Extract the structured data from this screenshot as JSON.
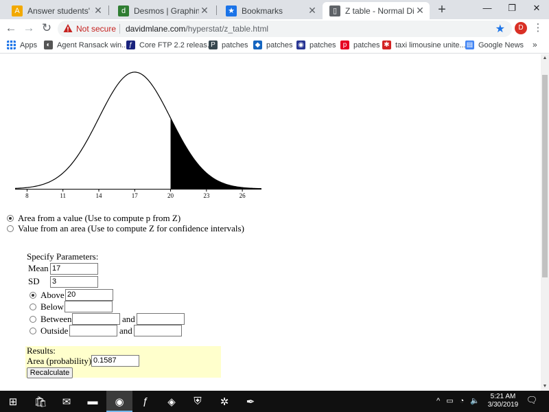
{
  "browser": {
    "tabs": [
      {
        "title": "Answer students' questio",
        "icon": "answers-site-icon",
        "favColor": "#f2a900",
        "glyph": "A"
      },
      {
        "title": "Desmos | Graphing Calcu",
        "icon": "desmos-icon",
        "favColor": "#2f7d32",
        "glyph": "d"
      },
      {
        "title": "Bookmarks",
        "icon": "bookmark-star-icon",
        "favColor": "#1a73e8",
        "glyph": "★"
      },
      {
        "title": "Z table - Normal Distribu",
        "icon": "page-icon",
        "favColor": "#5f6368",
        "glyph": "▯",
        "active": true
      }
    ],
    "new_tab_label": "+",
    "window_controls": {
      "minimize": "—",
      "restore": "❐",
      "close": "✕"
    },
    "security_label": "Not secure",
    "url_host": "davidmlane.com",
    "url_path": "/hyperstat/z_table.html",
    "profile_initial": "D"
  },
  "bookmarks": {
    "apps_label": "Apps",
    "items": [
      {
        "label": "Agent Ransack win...",
        "icon": "agent-ransack-icon",
        "color": "#555555",
        "glyph": "◐"
      },
      {
        "label": "Core FTP 2.2 releas...",
        "icon": "coreftp-icon",
        "color": "#1a237e",
        "glyph": "ƒ"
      },
      {
        "label": "patches",
        "icon": "patches-p-icon",
        "color": "#37474f",
        "glyph": "P"
      },
      {
        "label": "patches",
        "icon": "patches-drop-icon",
        "color": "#1565c0",
        "glyph": "◆"
      },
      {
        "label": "patches",
        "icon": "patches-circle-icon",
        "color": "#283593",
        "glyph": "◉"
      },
      {
        "label": "patches",
        "icon": "pinterest-icon",
        "color": "#e60023",
        "glyph": "p"
      },
      {
        "label": "taxi limousine unite...",
        "icon": "yelp-icon",
        "color": "#d32323",
        "glyph": "✱"
      },
      {
        "label": "Google News",
        "icon": "google-news-icon",
        "color": "#4285f4",
        "glyph": "▤"
      }
    ],
    "more_label": "»"
  },
  "z_table": {
    "chart_data": {
      "type": "area",
      "title": "",
      "distribution": "normal",
      "mean": 17,
      "sd": 3,
      "xlim": [
        7,
        27.6
      ],
      "x_ticks": [
        8,
        11,
        14,
        17,
        20,
        23,
        26
      ],
      "shaded_region": {
        "from": 20,
        "to": 27.6
      }
    },
    "mode_options": [
      {
        "label": "Area from a value (Use to compute p from Z)",
        "selected": true
      },
      {
        "label": "Value from an area (Use to compute Z for confidence intervals)",
        "selected": false
      }
    ],
    "params_heading": "Specify Parameters:",
    "mean_label": "Mean",
    "mean_value": "17",
    "sd_label": "SD",
    "sd_value": "3",
    "region_options": [
      {
        "label": "Above",
        "selected": true,
        "value": "20"
      },
      {
        "label": "Below",
        "selected": false,
        "value": ""
      },
      {
        "label": "Between",
        "selected": false,
        "value": "",
        "value2": ""
      },
      {
        "label": "Outside",
        "selected": false,
        "value": "",
        "value2": ""
      }
    ],
    "and_label": "and",
    "results_heading": "Results:",
    "area_label": "Area (probability)",
    "area_value": "0.1587",
    "recalculate_label": "Recalculate"
  },
  "taskbar": {
    "apps": [
      {
        "name": "windows-start-icon",
        "glyph": "⊞"
      },
      {
        "name": "store-icon",
        "glyph": "🛍"
      },
      {
        "name": "mail-icon",
        "glyph": "✉"
      },
      {
        "name": "file-explorer-icon",
        "glyph": "▬"
      },
      {
        "name": "chrome-icon",
        "glyph": "◉",
        "active": true
      },
      {
        "name": "firefox-dev-icon",
        "glyph": "ƒ"
      },
      {
        "name": "outlook-icon",
        "glyph": "◈"
      },
      {
        "name": "security-shield-icon",
        "glyph": "⛨"
      },
      {
        "name": "gear-app-icon",
        "glyph": "✲"
      },
      {
        "name": "pen-app-icon",
        "glyph": "✒"
      }
    ],
    "tray_icons": "^ ▭ ◔ 🔈",
    "time": "5:21 AM",
    "date": "3/30/2019",
    "notifications_count": "1"
  }
}
